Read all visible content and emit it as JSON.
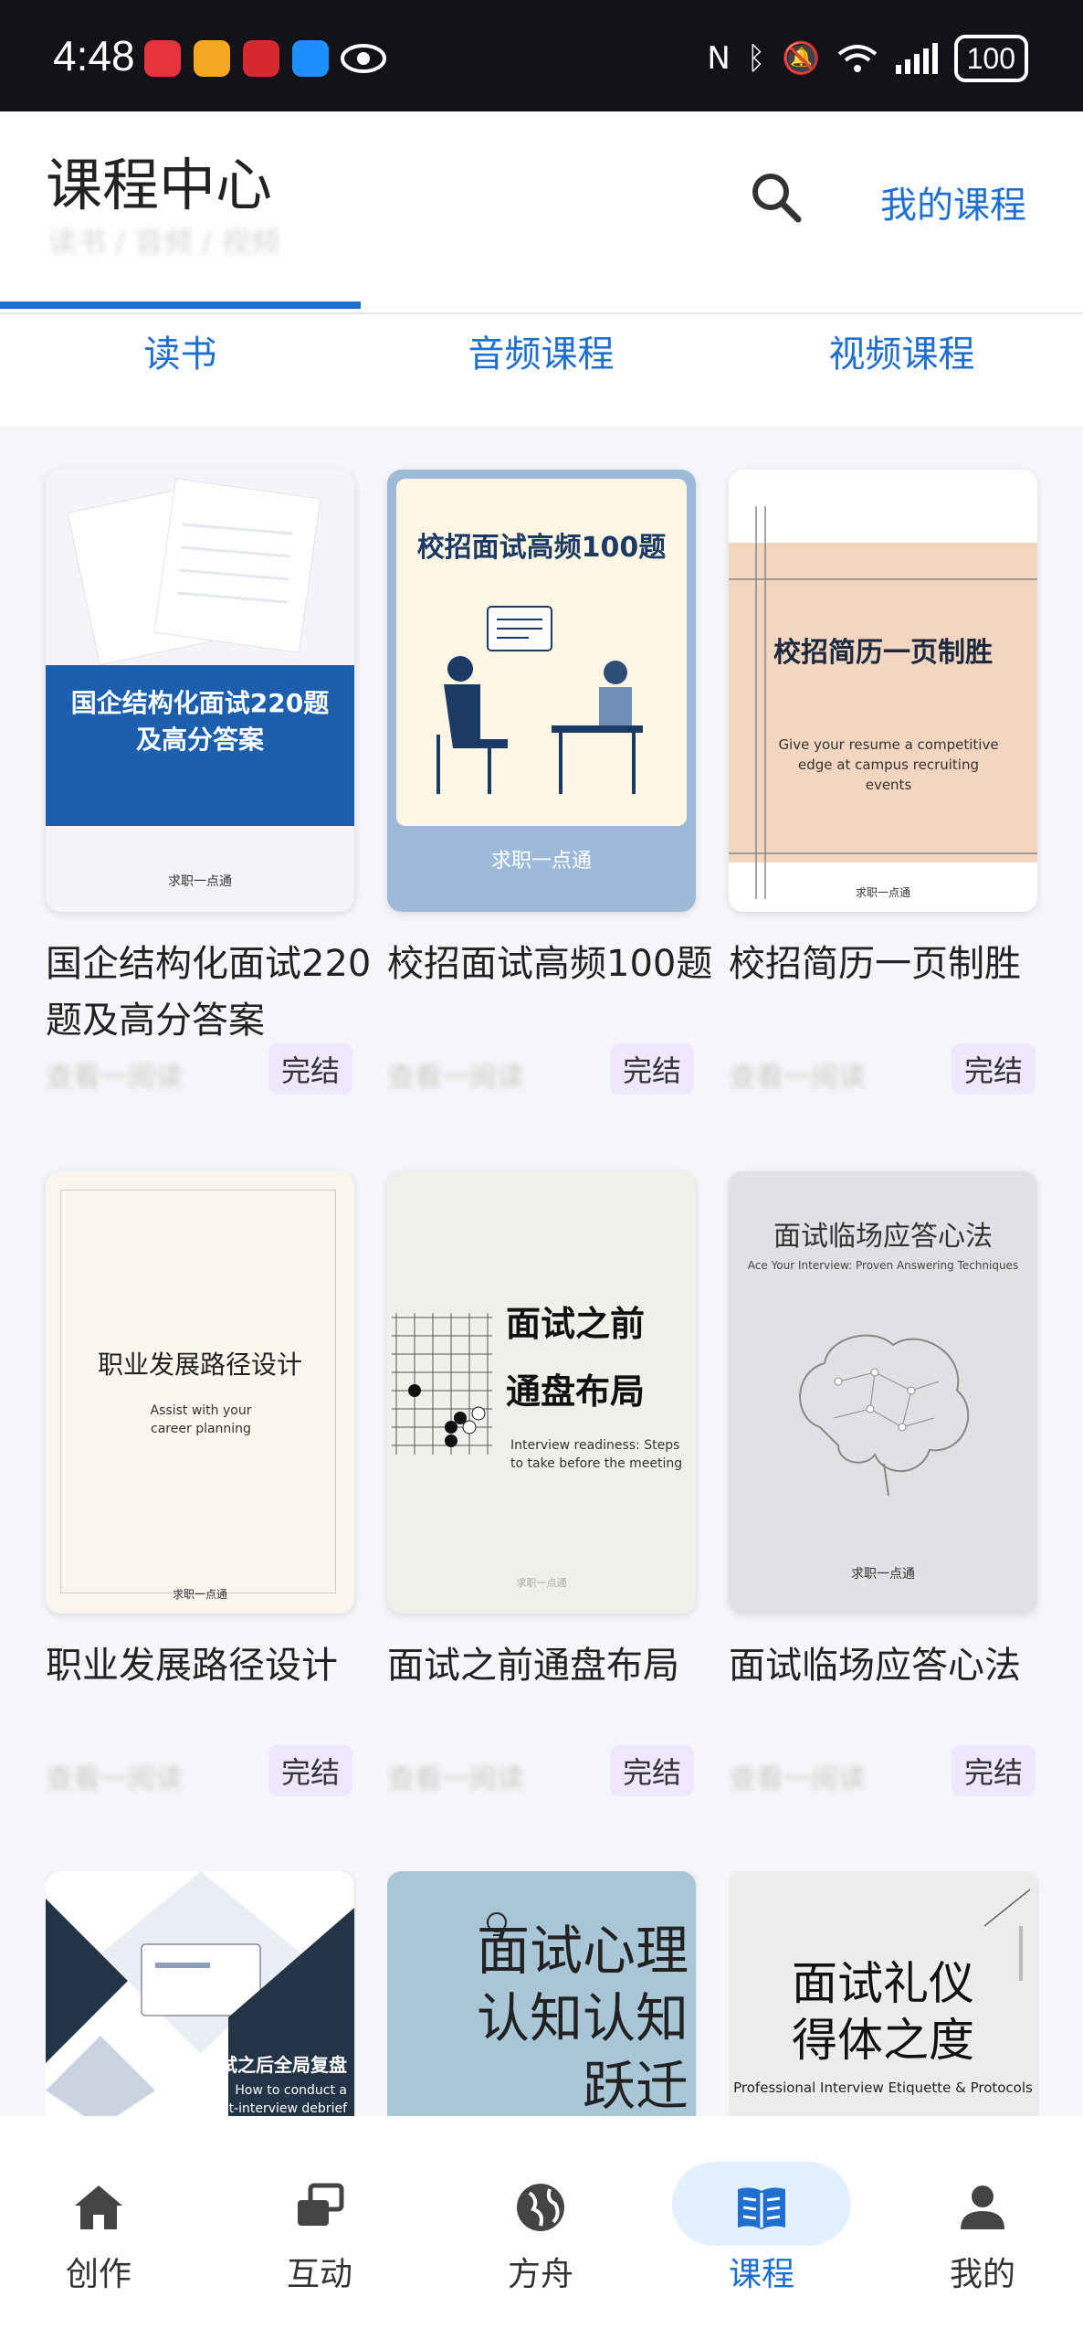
{
  "status_bar": {
    "time": "4:48",
    "battery": "100"
  },
  "header": {
    "title": "课程中心",
    "breadcrumb": "读书 / 音频 / 视频",
    "my_courses": "我的课程"
  },
  "tabs": [
    "读书",
    "音频课程",
    "视频课程"
  ],
  "active_tab": 0,
  "courses": [
    {
      "title": "国企结构化面试220 题及高分答案",
      "meta": "查看一阅读",
      "badge": "完结",
      "cover_title": "国企结构化面试220题\n及高分答案",
      "cover_brand": "求职一点通"
    },
    {
      "title": "校招面试高频100题",
      "meta": "查看一阅读",
      "badge": "完结",
      "cover_title": "校招面试高频100题",
      "cover_brand": "求职一点通"
    },
    {
      "title": "校招简历一页制胜",
      "meta": "查看一阅读",
      "badge": "完结",
      "cover_title": "校招简历一页制胜",
      "cover_sub": "Give your resume a competitive edge at campus recruiting events",
      "cover_brand": "求职一点通"
    },
    {
      "title": "职业发展路径设计",
      "meta": "查看一阅读",
      "badge": "完结",
      "cover_title": "职业发展路径设计",
      "cover_sub": "Assist with your career planning",
      "cover_brand": "求职一点通"
    },
    {
      "title": "面试之前通盘布局",
      "meta": "查看一阅读",
      "badge": "完结",
      "cover_title": "面试之前\n通盘布局",
      "cover_sub": "Interview readiness: Steps to take before the meeting",
      "cover_brand": "求职一点通"
    },
    {
      "title": "面试临场应答心法",
      "meta": "查看一阅读",
      "badge": "完结",
      "cover_title": "面试临场应答心法",
      "cover_sub": "Ace Your Interview: Proven Answering Techniques",
      "cover_brand": "求职一点通"
    },
    {
      "title": "",
      "cover_title": "面试之后全局复盘",
      "cover_sub": "How to conduct a post-interview debrief"
    },
    {
      "title": "",
      "cover_title": "面试心理\n认知认知\n跃迁"
    },
    {
      "title": "",
      "cover_title": "面试礼仪\n得体之度",
      "cover_sub": "Professional Interview Etiquette & Protocols"
    }
  ],
  "bottom_nav": [
    {
      "label": "创作",
      "icon": "home-icon"
    },
    {
      "label": "互动",
      "icon": "interact-icon"
    },
    {
      "label": "方舟",
      "icon": "globe-icon"
    },
    {
      "label": "课程",
      "icon": "book-icon",
      "active": true
    },
    {
      "label": "我的",
      "icon": "person-icon"
    }
  ]
}
